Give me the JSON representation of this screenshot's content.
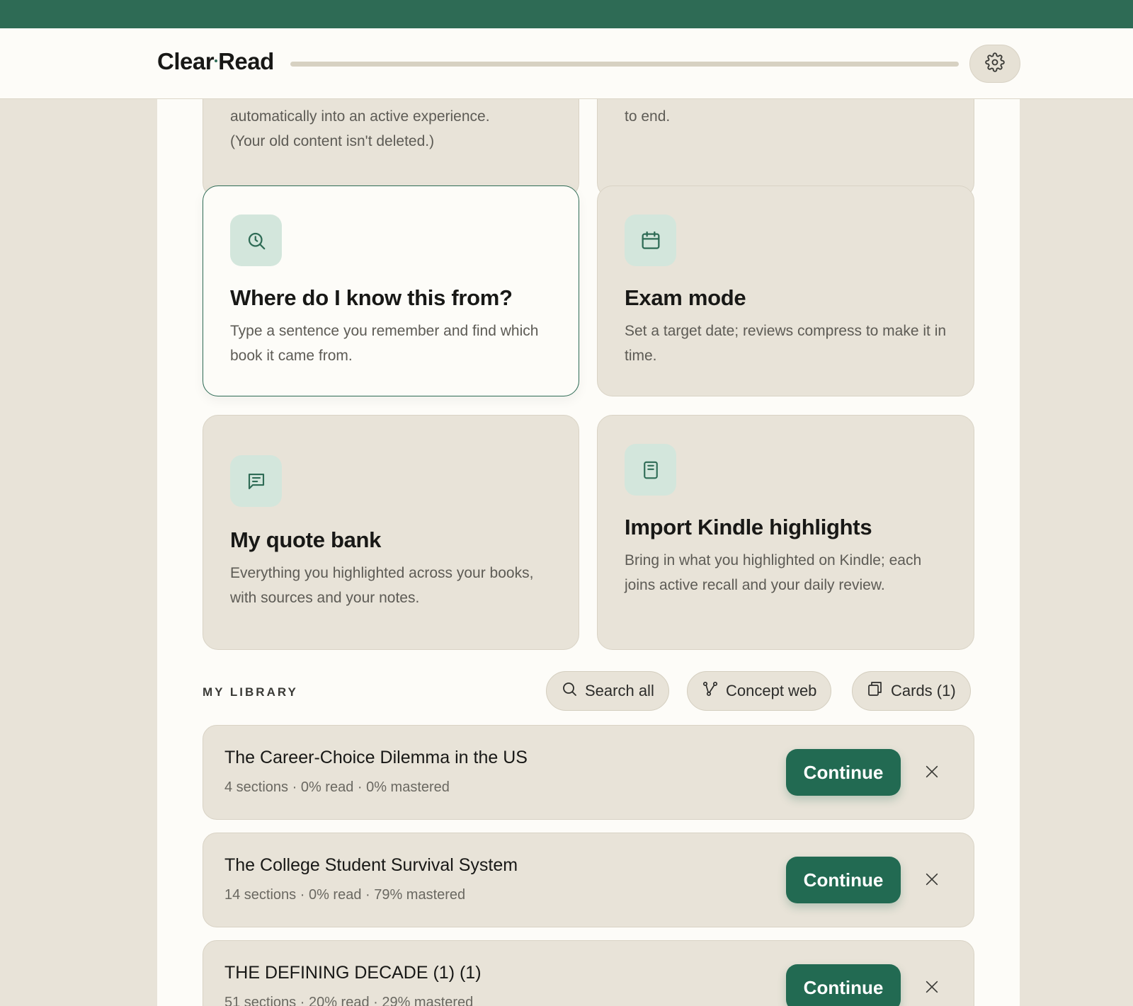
{
  "app": {
    "name_part1": "Clear",
    "name_part2": "Read",
    "progress_fraction": 0.0
  },
  "colors": {
    "accent": "#2e6b55",
    "background": "#e8e3d8",
    "surface": "#fdfcf8"
  },
  "partial_cards": {
    "left": {
      "line1": "automatically into an active experience.",
      "line2": "(Your old content isn't deleted.)"
    },
    "right": {
      "line": "to end."
    }
  },
  "feature_cards": [
    {
      "icon": "search-clock-icon",
      "title": "Where do I know this from?",
      "desc": "Type a sentence you remember and find which book it came from."
    },
    {
      "icon": "calendar-icon",
      "title": "Exam mode",
      "desc": "Set a target date; reviews compress to make it in time."
    },
    {
      "icon": "quote-icon",
      "title": "My quote bank",
      "desc": "Everything you highlighted across your books, with sources and your notes."
    },
    {
      "icon": "book-icon",
      "title": "Import Kindle highlights",
      "desc": "Bring in what you highlighted on Kindle; each joins active recall and your daily review."
    }
  ],
  "library": {
    "label": "MY LIBRARY",
    "actions": {
      "search_all": "Search all",
      "concept_web": "Concept web",
      "cards": "Cards (1)"
    },
    "items": [
      {
        "title": "The Career-Choice Dilemma in the US",
        "meta": "4 sections · 0% read · 0% mastered",
        "button": "Continue"
      },
      {
        "title": "The College Student Survival System",
        "meta": "14 sections · 0% read · 79% mastered",
        "button": "Continue"
      },
      {
        "title": "THE DEFINING DECADE (1) (1)",
        "meta": "51 sections · 20% read · 29% mastered",
        "button": "Continue"
      }
    ]
  }
}
